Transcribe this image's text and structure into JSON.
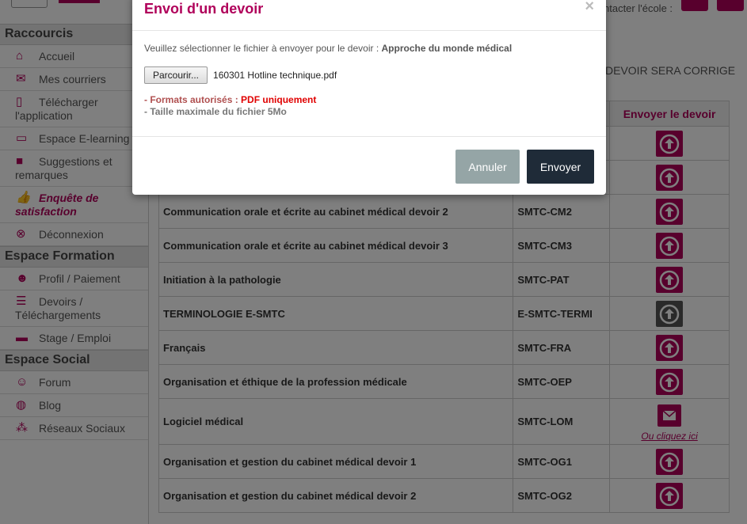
{
  "header": {
    "contact_label": "ntacter l'école :"
  },
  "sidebar": {
    "sections": [
      {
        "title": "Raccourcis",
        "items": [
          {
            "label": "Accueil",
            "icon": "home-icon"
          },
          {
            "label": "Mes courriers",
            "icon": "envelope-icon"
          },
          {
            "label": "Télécharger l'application",
            "icon": "mobile-icon"
          },
          {
            "label": "Espace E-learning",
            "icon": "monitor-icon"
          },
          {
            "label": "Suggestions et remarques",
            "icon": "comment-alert-icon"
          },
          {
            "label": "Enquête de satisfaction",
            "icon": "thumbs-up-icon"
          },
          {
            "label": "Déconnexion",
            "icon": "close-circle-icon"
          }
        ]
      },
      {
        "title": "Espace Formation",
        "items": [
          {
            "label": "Profil / Paiement",
            "icon": "user-icon"
          },
          {
            "label": "Devoirs / Téléchargements",
            "icon": "document-icon"
          },
          {
            "label": "Stage / Emploi",
            "icon": "briefcase-icon"
          }
        ]
      },
      {
        "title": "Espace Social",
        "items": [
          {
            "label": "Forum",
            "icon": "users-icon"
          },
          {
            "label": "Blog",
            "icon": "globe-icon"
          },
          {
            "label": "Réseaux Sociaux",
            "icon": "share-icon"
          }
        ]
      }
    ]
  },
  "main": {
    "corrige_text": "DEVOIR SERA CORRIGE",
    "table_header_action": "Envoyer le devoir",
    "rows": [
      {
        "name": "Communication orale et écrite au cabinet médical devoir 2",
        "code": "SMTC-CM2",
        "action": "upload"
      },
      {
        "name": "Communication orale et écrite au cabinet médical devoir 3",
        "code": "SMTC-CM3",
        "action": "upload"
      },
      {
        "name": "Initiation à la pathologie",
        "code": "SMTC-PAT",
        "action": "upload"
      },
      {
        "name": "TERMINOLOGIE E-SMTC",
        "code": "E-SMTC-TERMI",
        "action": "upload-disabled"
      },
      {
        "name": "Français",
        "code": "SMTC-FRA",
        "action": "upload"
      },
      {
        "name": "Organisation et éthique de la profession médicale",
        "code": "SMTC-OEP",
        "action": "upload"
      },
      {
        "name": "Logiciel médical",
        "code": "SMTC-LOM",
        "action": "mail",
        "link": "Ou cliquez ici"
      },
      {
        "name": "Organisation et gestion du cabinet médical devoir 1",
        "code": "SMTC-OG1",
        "action": "upload"
      },
      {
        "name": "Organisation et gestion du cabinet médical devoir 2",
        "code": "SMTC-OG2",
        "action": "upload"
      }
    ]
  },
  "modal": {
    "title": "Envoi d'un devoir",
    "close_symbol": "×",
    "prompt_text": "Veuillez sélectionner le fichier à envoyer pour le devoir : ",
    "prompt_subject": "Approche du monde médical",
    "browse_label": "Parcourir...",
    "file_name": "160301 Hotline technique.pdf",
    "rule_formats_label": "- Formats autorisés : ",
    "rule_formats_value": "PDF uniquement",
    "rule_size": "- Taille maximale du fichier 5Mo",
    "cancel_label": "Annuler",
    "send_label": "Envoyer"
  },
  "colors": {
    "brand": "#b0005a",
    "send_button": "#1f2b38",
    "cancel_button": "#95a5a6",
    "format_highlight": "#e00000"
  }
}
